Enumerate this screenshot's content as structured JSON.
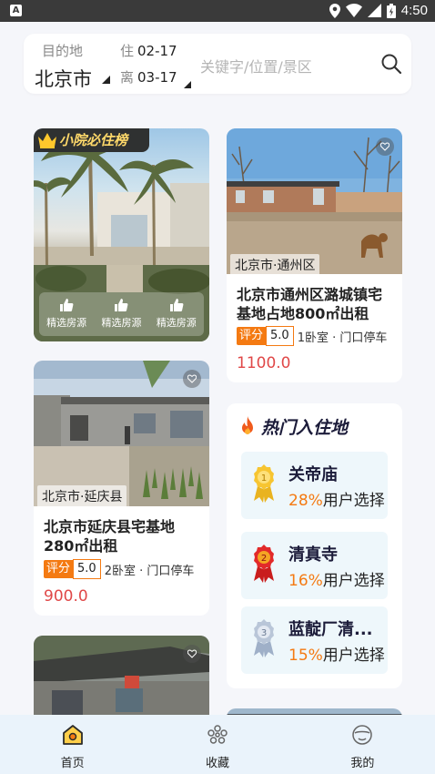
{
  "status_bar": {
    "time": "4:50",
    "notification_label": "A"
  },
  "search": {
    "destination_label": "目的地",
    "destination_value": "北京市",
    "checkin_prefix": "住",
    "checkin_date": "02-17",
    "checkout_prefix": "离",
    "checkout_date": "03-17",
    "keyword_placeholder": "关键字/位置/景区"
  },
  "featured": {
    "badge": "小院必住榜",
    "items": [
      {
        "label": "精选房源"
      },
      {
        "label": "精选房源"
      },
      {
        "label": "精选房源"
      }
    ]
  },
  "listings": [
    {
      "location": "北京市·通州区",
      "title": "北京市通州区潞城镇宅基地占地800㎡出租",
      "rating_label": "评分",
      "rating": "5.0",
      "features": "1卧室 · 门口停车",
      "price": "1100.0"
    },
    {
      "location": "北京市·延庆县",
      "title": "北京市延庆县宅基地280㎡出租",
      "rating_label": "评分",
      "rating": "5.0",
      "features": "2卧室 · 门口停车",
      "price": "900.0"
    }
  ],
  "hot": {
    "title": "热门入住地",
    "items": [
      {
        "name": "关帝庙",
        "percent": "28%",
        "suffix": "用户选择",
        "medal": "gold-medal-icon",
        "medal_number": "1"
      },
      {
        "name": "清真寺",
        "percent": "16%",
        "suffix": "用户选择",
        "medal": "red-medal-icon",
        "medal_number": "2"
      },
      {
        "name": "蓝靛厂清...",
        "percent": "15%",
        "suffix": "用户选择",
        "medal": "silver-medal-icon",
        "medal_number": "3"
      }
    ]
  },
  "bottom_nav": {
    "items": [
      {
        "label": "首页",
        "icon": "home-icon"
      },
      {
        "label": "收藏",
        "icon": "favorites-icon"
      },
      {
        "label": "我的",
        "icon": "profile-icon"
      }
    ]
  },
  "colors": {
    "accent": "#f47a12",
    "price": "#e04848",
    "nav_bg": "#eaf3fb",
    "badge_text": "#ffd96a"
  }
}
